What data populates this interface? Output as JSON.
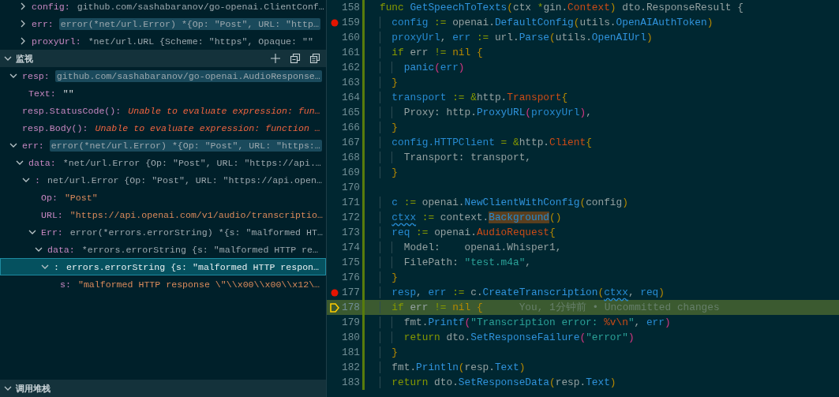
{
  "variables": {
    "rows": [
      {
        "name": "config:",
        "value": "github.com/sashabaranov/go-openai.ClientConf…",
        "expanded": false,
        "value_highlighted": false
      },
      {
        "name": "err:",
        "value": "error(*net/url.Error) *{Op: \"Post\", URL: \"http…",
        "expanded": false,
        "value_highlighted": true
      },
      {
        "name": "proxyUrl:",
        "value": "*net/url.URL {Scheme: \"https\", Opaque: \"\"",
        "expanded": false,
        "value_highlighted": false
      }
    ]
  },
  "watch": {
    "title": "监视",
    "items": [
      {
        "kind": "group",
        "name": "resp:",
        "value": {
          "kind": "object",
          "text": "github.com/sashabaranov/go-openai.AudioResponse…"
        },
        "expanded": true,
        "selected": false,
        "value_highlighted": true,
        "children": [
          {
            "kind": "leaf",
            "name": "Text:",
            "value": {
              "kind": "literal",
              "text": "\"\""
            },
            "selected": false,
            "value_highlighted": false
          }
        ]
      },
      {
        "kind": "leaf",
        "name": "resp.StatusCode():",
        "value": {
          "kind": "error",
          "text": "Unable to evaluate expression: fun…"
        },
        "selected": false,
        "value_highlighted": false
      },
      {
        "kind": "leaf",
        "name": "resp.Body():",
        "value": {
          "kind": "error",
          "text": "Unable to evaluate expression: function …"
        },
        "selected": false,
        "value_highlighted": false
      },
      {
        "kind": "group",
        "name": "err:",
        "value": {
          "kind": "object",
          "text": "error(*net/url.Error) *{Op: \"Post\", URL: \"https:…"
        },
        "expanded": true,
        "selected": false,
        "value_highlighted": true,
        "children": [
          {
            "kind": "group",
            "name": "data:",
            "value": {
              "kind": "object",
              "text": "*net/url.Error {Op: \"Post\", URL: \"https://api.…"
            },
            "expanded": true,
            "selected": false,
            "value_highlighted": false,
            "children": [
              {
                "kind": "group",
                "name": ":",
                "value": {
                  "kind": "object",
                  "text": "net/url.Error {Op: \"Post\", URL: \"https://api.open…"
                },
                "expanded": true,
                "selected": false,
                "value_highlighted": false,
                "children": [
                  {
                    "kind": "leaf",
                    "name": "Op:",
                    "value": {
                      "kind": "string",
                      "text": "\"Post\""
                    },
                    "selected": false,
                    "value_highlighted": false
                  },
                  {
                    "kind": "leaf",
                    "name": "URL:",
                    "value": {
                      "kind": "string",
                      "text": "\"https://api.openai.com/v1/audio/transcriptio…"
                    },
                    "selected": false,
                    "value_highlighted": false
                  },
                  {
                    "kind": "group",
                    "name": "Err:",
                    "value": {
                      "kind": "object",
                      "text": "error(*errors.errorString) *{s: \"malformed HT…"
                    },
                    "expanded": true,
                    "selected": false,
                    "value_highlighted": false,
                    "children": [
                      {
                        "kind": "group",
                        "name": "data:",
                        "value": {
                          "kind": "object",
                          "text": "*errors.errorString {s: \"malformed HTTP re…"
                        },
                        "expanded": true,
                        "selected": false,
                        "value_highlighted": false,
                        "children": [
                          {
                            "kind": "group",
                            "name": ":",
                            "value": {
                              "kind": "object",
                              "text": "errors.errorString {s: \"malformed HTTP respon…"
                            },
                            "expanded": true,
                            "selected": true,
                            "value_highlighted": false,
                            "children": [
                              {
                                "kind": "leaf",
                                "name": "s:",
                                "value": {
                                  "kind": "string",
                                  "text": "\"malformed HTTP response \\\"\\\\x00\\\\x00\\\\x12\\…"
                                },
                                "selected": false,
                                "value_highlighted": false
                              }
                            ]
                          }
                        ]
                      }
                    ]
                  }
                ]
              }
            ]
          }
        ]
      }
    ]
  },
  "call_stack": {
    "title": "调用堆栈",
    "expanded": true
  },
  "code": {
    "lines": [
      {
        "number": "158",
        "breakpoint": false,
        "current": false,
        "tokens": [
          {
            "kind": "kw",
            "text": "func "
          },
          {
            "kind": "fn",
            "text": "GetSpeechToTexts"
          },
          {
            "kind": "br",
            "text": "("
          },
          {
            "kind": "plain",
            "text": "ctx "
          },
          {
            "kind": "kw",
            "text": "*"
          },
          {
            "kind": "plain",
            "text": "gin."
          },
          {
            "kind": "type",
            "text": "Context"
          },
          {
            "kind": "br",
            "text": ")"
          },
          {
            "kind": "plain",
            "text": " dto.ResponseResult {"
          }
        ]
      },
      {
        "number": "159",
        "breakpoint": true,
        "current": false,
        "tokens": [
          {
            "kind": "var",
            "text": "  config"
          },
          {
            "kind": "kw",
            "text": " := "
          },
          {
            "kind": "plain",
            "text": "openai."
          },
          {
            "kind": "fn",
            "text": "DefaultConfig"
          },
          {
            "kind": "br",
            "text": "("
          },
          {
            "kind": "plain",
            "text": "utils."
          },
          {
            "kind": "fn",
            "text": "OpenAIAuthToken"
          },
          {
            "kind": "br",
            "text": ")"
          }
        ]
      },
      {
        "number": "160",
        "breakpoint": false,
        "current": false,
        "tokens": [
          {
            "kind": "var",
            "text": "  proxyUrl"
          },
          {
            "kind": "plain",
            "text": ", "
          },
          {
            "kind": "var",
            "text": "err"
          },
          {
            "kind": "kw",
            "text": " := "
          },
          {
            "kind": "plain",
            "text": "url."
          },
          {
            "kind": "fn",
            "text": "Parse"
          },
          {
            "kind": "br",
            "text": "("
          },
          {
            "kind": "plain",
            "text": "utils."
          },
          {
            "kind": "fn",
            "text": "OpenAIUrl"
          },
          {
            "kind": "br",
            "text": ")"
          }
        ]
      },
      {
        "number": "161",
        "breakpoint": false,
        "current": false,
        "tokens": [
          {
            "kind": "kw",
            "text": "  if"
          },
          {
            "kind": "plain",
            "text": " err "
          },
          {
            "kind": "kw",
            "text": "!="
          },
          {
            "kind": "const",
            "text": " nil"
          },
          {
            "kind": "br",
            "text": " {"
          }
        ]
      },
      {
        "number": "162",
        "breakpoint": false,
        "current": false,
        "tokens": [
          {
            "kind": "fn",
            "text": "    panic"
          },
          {
            "kind": "br2",
            "text": "("
          },
          {
            "kind": "var",
            "text": "err"
          },
          {
            "kind": "br2",
            "text": ")"
          }
        ]
      },
      {
        "number": "163",
        "breakpoint": false,
        "current": false,
        "tokens": [
          {
            "kind": "br",
            "text": "  }"
          }
        ]
      },
      {
        "number": "164",
        "breakpoint": false,
        "current": false,
        "tokens": [
          {
            "kind": "var",
            "text": "  transport"
          },
          {
            "kind": "kw",
            "text": " := &"
          },
          {
            "kind": "plain",
            "text": "http."
          },
          {
            "kind": "type",
            "text": "Transport"
          },
          {
            "kind": "br",
            "text": "{"
          }
        ]
      },
      {
        "number": "165",
        "breakpoint": false,
        "current": false,
        "tokens": [
          {
            "kind": "plain",
            "text": "    Proxy: http."
          },
          {
            "kind": "fn",
            "text": "ProxyURL"
          },
          {
            "kind": "br2",
            "text": "("
          },
          {
            "kind": "var",
            "text": "proxyUrl"
          },
          {
            "kind": "br2",
            "text": ")"
          },
          {
            "kind": "plain",
            "text": ","
          }
        ]
      },
      {
        "number": "166",
        "breakpoint": false,
        "current": false,
        "tokens": [
          {
            "kind": "br",
            "text": "  }"
          }
        ]
      },
      {
        "number": "167",
        "breakpoint": false,
        "current": false,
        "tokens": [
          {
            "kind": "var",
            "text": "  config.HTTPClient"
          },
          {
            "kind": "kw",
            "text": " = &"
          },
          {
            "kind": "plain",
            "text": "http."
          },
          {
            "kind": "type",
            "text": "Client"
          },
          {
            "kind": "br",
            "text": "{"
          }
        ]
      },
      {
        "number": "168",
        "breakpoint": false,
        "current": false,
        "tokens": [
          {
            "kind": "plain",
            "text": "    Transport: transport,"
          }
        ]
      },
      {
        "number": "169",
        "breakpoint": false,
        "current": false,
        "tokens": [
          {
            "kind": "br",
            "text": "  }"
          }
        ]
      },
      {
        "number": "170",
        "breakpoint": false,
        "current": false
      },
      {
        "number": "171",
        "breakpoint": false,
        "current": false,
        "tokens": [
          {
            "kind": "var",
            "text": "  c"
          },
          {
            "kind": "kw",
            "text": " := "
          },
          {
            "kind": "plain",
            "text": "openai."
          },
          {
            "kind": "fn",
            "text": "NewClientWithConfig"
          },
          {
            "kind": "br",
            "text": "("
          },
          {
            "kind": "plain",
            "text": "config"
          },
          {
            "kind": "br",
            "text": ")"
          }
        ]
      },
      {
        "number": "172",
        "breakpoint": false,
        "current": false,
        "tokens": [
          {
            "kind": "squiggle",
            "text": "  ctxx"
          },
          {
            "kind": "kw",
            "text": " := "
          },
          {
            "kind": "plain",
            "text": "context."
          },
          {
            "kind": "match",
            "text": "Background"
          },
          {
            "kind": "br",
            "text": "()"
          }
        ]
      },
      {
        "number": "173",
        "breakpoint": false,
        "current": false,
        "tokens": [
          {
            "kind": "var",
            "text": "  req"
          },
          {
            "kind": "kw",
            "text": " := "
          },
          {
            "kind": "plain",
            "text": "openai."
          },
          {
            "kind": "type",
            "text": "AudioRequest"
          },
          {
            "kind": "br",
            "text": "{"
          }
        ]
      },
      {
        "number": "174",
        "breakpoint": false,
        "current": false,
        "tokens": [
          {
            "kind": "plain",
            "text": "    Model:    openai.Whisper1,"
          }
        ]
      },
      {
        "number": "175",
        "breakpoint": false,
        "current": false,
        "tokens": [
          {
            "kind": "plain",
            "text": "    FilePath: "
          },
          {
            "kind": "str",
            "text": "\"test.m4a\""
          },
          {
            "kind": "plain",
            "text": ","
          }
        ]
      },
      {
        "number": "176",
        "breakpoint": false,
        "current": false,
        "tokens": [
          {
            "kind": "br",
            "text": "  }"
          }
        ]
      },
      {
        "number": "177",
        "breakpoint": true,
        "current": false,
        "tokens": [
          {
            "kind": "var",
            "text": "  resp"
          },
          {
            "kind": "plain",
            "text": ", "
          },
          {
            "kind": "var",
            "text": "err"
          },
          {
            "kind": "kw",
            "text": " := "
          },
          {
            "kind": "plain",
            "text": "c."
          },
          {
            "kind": "fn",
            "text": "CreateTranscription"
          },
          {
            "kind": "br",
            "text": "("
          },
          {
            "kind": "squiggle",
            "text": "ctxx"
          },
          {
            "kind": "plain",
            "text": ", "
          },
          {
            "kind": "var",
            "text": "req"
          },
          {
            "kind": "br",
            "text": ")"
          }
        ]
      },
      {
        "number": "178",
        "breakpoint": false,
        "current": true,
        "tokens": [
          {
            "kind": "kw",
            "text": "  if"
          },
          {
            "kind": "plain",
            "text": " err "
          },
          {
            "kind": "kw",
            "text": "!="
          },
          {
            "kind": "const",
            "text": " nil"
          },
          {
            "kind": "br",
            "text": " {"
          },
          {
            "kind": "ghost",
            "text": "      You, 1分钟前 • Uncommitted changes"
          }
        ]
      },
      {
        "number": "179",
        "breakpoint": false,
        "current": false,
        "tokens": [
          {
            "kind": "plain",
            "text": "    fmt."
          },
          {
            "kind": "fn",
            "text": "Printf"
          },
          {
            "kind": "br2",
            "text": "("
          },
          {
            "kind": "str",
            "text": "\"Transcription error: "
          },
          {
            "kind": "esc",
            "text": "%v\\n"
          },
          {
            "kind": "str",
            "text": "\""
          },
          {
            "kind": "plain",
            "text": ", "
          },
          {
            "kind": "var",
            "text": "err"
          },
          {
            "kind": "br2",
            "text": ")"
          }
        ]
      },
      {
        "number": "180",
        "breakpoint": false,
        "current": false,
        "tokens": [
          {
            "kind": "kw",
            "text": "    return"
          },
          {
            "kind": "plain",
            "text": " dto."
          },
          {
            "kind": "fn",
            "text": "SetResponseFailure"
          },
          {
            "kind": "br2",
            "text": "("
          },
          {
            "kind": "str",
            "text": "\"error\""
          },
          {
            "kind": "br2",
            "text": ")"
          }
        ]
      },
      {
        "number": "181",
        "breakpoint": false,
        "current": false,
        "tokens": [
          {
            "kind": "br",
            "text": "  }"
          }
        ]
      },
      {
        "number": "182",
        "breakpoint": false,
        "current": false,
        "tokens": [
          {
            "kind": "plain",
            "text": "  fmt."
          },
          {
            "kind": "fn",
            "text": "Println"
          },
          {
            "kind": "br",
            "text": "("
          },
          {
            "kind": "plain",
            "text": "resp."
          },
          {
            "kind": "fn",
            "text": "Text"
          },
          {
            "kind": "br",
            "text": ")"
          }
        ]
      },
      {
        "number": "183",
        "breakpoint": false,
        "current": false,
        "tokens": [
          {
            "kind": "kw",
            "text": "  return"
          },
          {
            "kind": "plain",
            "text": " dto."
          },
          {
            "kind": "fn",
            "text": "SetResponseData"
          },
          {
            "kind": "br",
            "text": "("
          },
          {
            "kind": "plain",
            "text": "resp."
          },
          {
            "kind": "fn",
            "text": "Text"
          },
          {
            "kind": "br",
            "text": ")"
          }
        ]
      }
    ]
  }
}
